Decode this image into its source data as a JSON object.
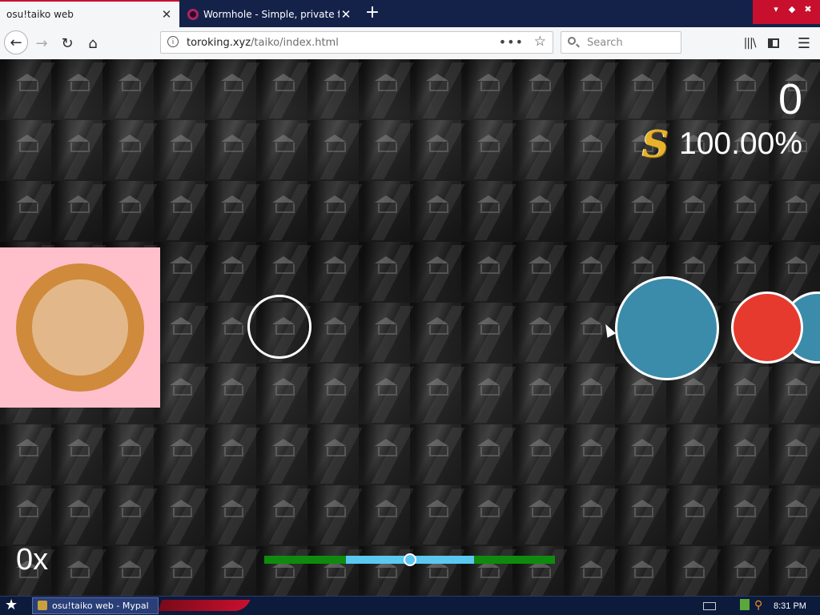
{
  "browser": {
    "tabs": [
      {
        "label": "osu!taiko web",
        "close": "✕",
        "active": true
      },
      {
        "label": "Wormhole - Simple, private file sha",
        "close": "✕",
        "active": false
      }
    ],
    "new_tab": "+",
    "url": {
      "domain": "toroking.xyz",
      "path": "/taiko/index.html",
      "more": "•••"
    },
    "search_placeholder": "Search",
    "icons": [
      "back-icon",
      "forward-icon",
      "reload-icon",
      "home-icon",
      "info-icon",
      "page-actions-icon",
      "bookmark-star-icon",
      "search-icon",
      "library-icon",
      "sidebar-icon",
      "menu-icon"
    ]
  },
  "game": {
    "score": "0",
    "rank": "S",
    "accuracy": "100.00%",
    "combo": "0x",
    "progress": {
      "start": 0.28,
      "end": 0.72,
      "position": 0.5
    },
    "colors": {
      "don": "#e63a2e",
      "kat": "#3a8caa",
      "drum_panel": "#ffc0cb",
      "drum_rim": "#d08a3c",
      "drum_face": "#e2b88a",
      "progress_track": "#0f8a0f",
      "progress_window": "#5bc8f0"
    }
  },
  "taskbar": {
    "task_label": "osu!taiko web - Mypal",
    "clock": "8:31 PM"
  }
}
